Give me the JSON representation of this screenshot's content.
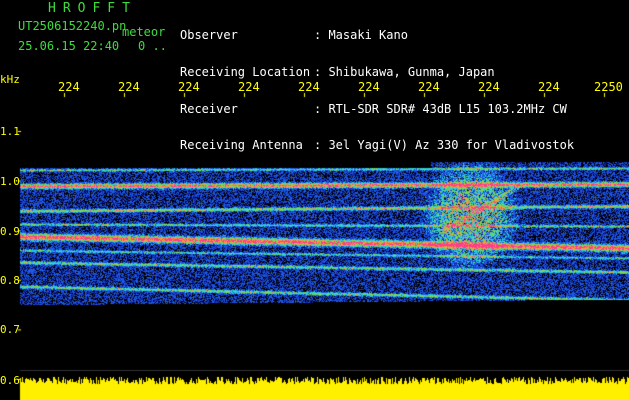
{
  "app": {
    "title": "HROFFT",
    "file_name": "UT2506152240.pn",
    "tag": "meteor",
    "datetime": "25.06.15 22:40",
    "extra": "0 .."
  },
  "header": {
    "labels": [
      "Observer",
      "Receiving Location",
      "Receiver",
      "Receiving Antenna"
    ],
    "values": [
      ": Masaki Kano",
      ": Shibukawa, Gunma, Japan",
      ": RTL-SDR SDR# 43dB L15 103.2MHz CW",
      ": 3el Yagi(V) Az 330 for Vladivostok"
    ]
  },
  "axes": {
    "y_unit": "kHz",
    "x_ticks": [
      "224",
      "224",
      "224",
      "224",
      "224",
      "224",
      "224",
      "224",
      "224",
      "2250"
    ],
    "y_ticks": [
      "1.1",
      "1.0",
      "0.9",
      "0.8",
      "0.7",
      "0.6"
    ]
  },
  "colors": {
    "background": "#000000",
    "text_green": "#3ddc3d",
    "text_white": "#ffffff",
    "axis_yellow": "#ffff00",
    "signal_magenta": "#ff3c8c",
    "noise_blue": "#1e3cc8"
  }
}
